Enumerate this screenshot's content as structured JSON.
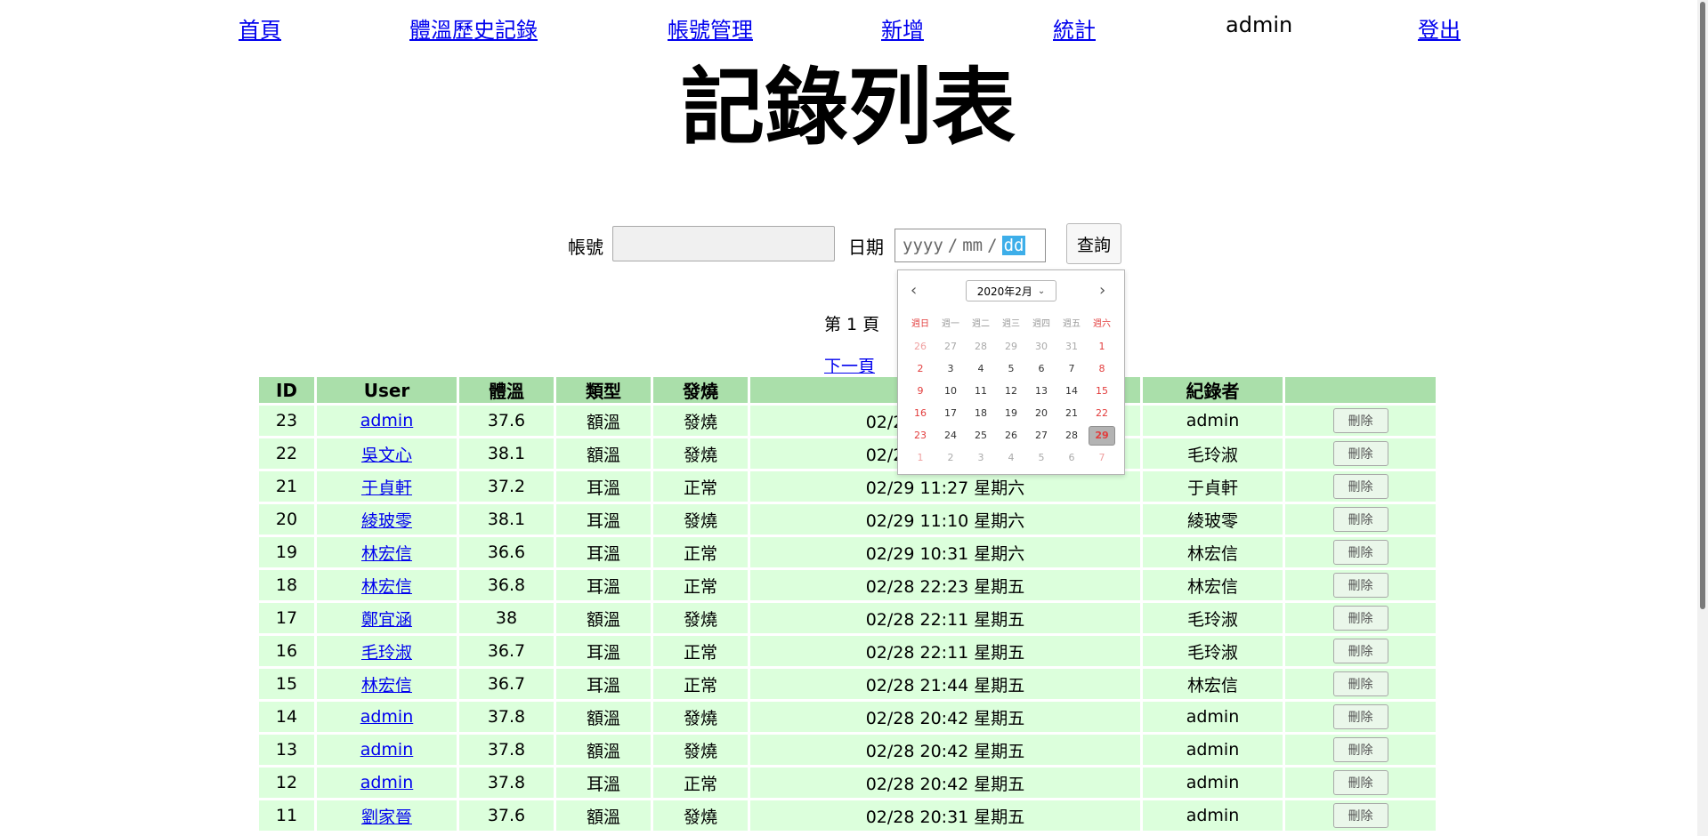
{
  "nav": {
    "home": "首頁",
    "history": "體溫歷史記錄",
    "accounts": "帳號管理",
    "add": "新增",
    "stats": "統計",
    "user": "admin",
    "logout": "登出"
  },
  "title": "記錄列表",
  "search": {
    "account_label": "帳號",
    "account_value": "",
    "date_label": "日期",
    "date_placeholder_year": "yyyy",
    "date_placeholder_month": "mm",
    "date_placeholder_day": "dd",
    "query_button": "查詢"
  },
  "datepicker": {
    "month_label": "2020年2月",
    "weekdays": [
      "週日",
      "週一",
      "週二",
      "週三",
      "週四",
      "週五",
      "週六"
    ],
    "days": [
      "26",
      "27",
      "28",
      "29",
      "30",
      "31",
      "1",
      "2",
      "3",
      "4",
      "5",
      "6",
      "7",
      "8",
      "9",
      "10",
      "11",
      "12",
      "13",
      "14",
      "15",
      "16",
      "17",
      "18",
      "19",
      "20",
      "21",
      "22",
      "23",
      "24",
      "25",
      "26",
      "27",
      "28",
      "29",
      "1",
      "2",
      "3",
      "4",
      "5",
      "6",
      "7"
    ],
    "selected": "29"
  },
  "pagination": {
    "page_label": "第 1 頁",
    "next": "下一頁"
  },
  "table": {
    "headers": [
      "ID",
      "User",
      "體溫",
      "類型",
      "發燒",
      "",
      "紀錄者",
      ""
    ],
    "delete_label": "刪除",
    "rows": [
      {
        "id": "23",
        "user": "admin",
        "temp": "37.6",
        "type": "額溫",
        "fever": "發燒",
        "time": "02/29 11:43 星期六",
        "recorder": "admin"
      },
      {
        "id": "22",
        "user": "吳文心",
        "temp": "38.1",
        "type": "額溫",
        "fever": "發燒",
        "time": "02/29 11:32 星期六",
        "recorder": "毛玲淑"
      },
      {
        "id": "21",
        "user": "于貞軒",
        "temp": "37.2",
        "type": "耳溫",
        "fever": "正常",
        "time": "02/29 11:27 星期六",
        "recorder": "于貞軒"
      },
      {
        "id": "20",
        "user": "綾玻零",
        "temp": "38.1",
        "type": "耳溫",
        "fever": "發燒",
        "time": "02/29 11:10 星期六",
        "recorder": "綾玻零"
      },
      {
        "id": "19",
        "user": "林宏信",
        "temp": "36.6",
        "type": "耳溫",
        "fever": "正常",
        "time": "02/29 10:31 星期六",
        "recorder": "林宏信"
      },
      {
        "id": "18",
        "user": "林宏信",
        "temp": "36.8",
        "type": "耳溫",
        "fever": "正常",
        "time": "02/28 22:23 星期五",
        "recorder": "林宏信"
      },
      {
        "id": "17",
        "user": "鄭宜涵",
        "temp": "38",
        "type": "額溫",
        "fever": "發燒",
        "time": "02/28 22:11 星期五",
        "recorder": "毛玲淑"
      },
      {
        "id": "16",
        "user": "毛玲淑",
        "temp": "36.7",
        "type": "耳溫",
        "fever": "正常",
        "time": "02/28 22:11 星期五",
        "recorder": "毛玲淑"
      },
      {
        "id": "15",
        "user": "林宏信",
        "temp": "36.7",
        "type": "耳溫",
        "fever": "正常",
        "time": "02/28 21:44 星期五",
        "recorder": "林宏信"
      },
      {
        "id": "14",
        "user": "admin",
        "temp": "37.8",
        "type": "額溫",
        "fever": "發燒",
        "time": "02/28 20:42 星期五",
        "recorder": "admin"
      },
      {
        "id": "13",
        "user": "admin",
        "temp": "37.8",
        "type": "額溫",
        "fever": "發燒",
        "time": "02/28 20:42 星期五",
        "recorder": "admin"
      },
      {
        "id": "12",
        "user": "admin",
        "temp": "37.8",
        "type": "耳溫",
        "fever": "正常",
        "time": "02/28 20:42 星期五",
        "recorder": "admin"
      },
      {
        "id": "11",
        "user": "劉家晉",
        "temp": "37.6",
        "type": "額溫",
        "fever": "發燒",
        "time": "02/28 20:31 星期五",
        "recorder": "admin"
      }
    ]
  }
}
